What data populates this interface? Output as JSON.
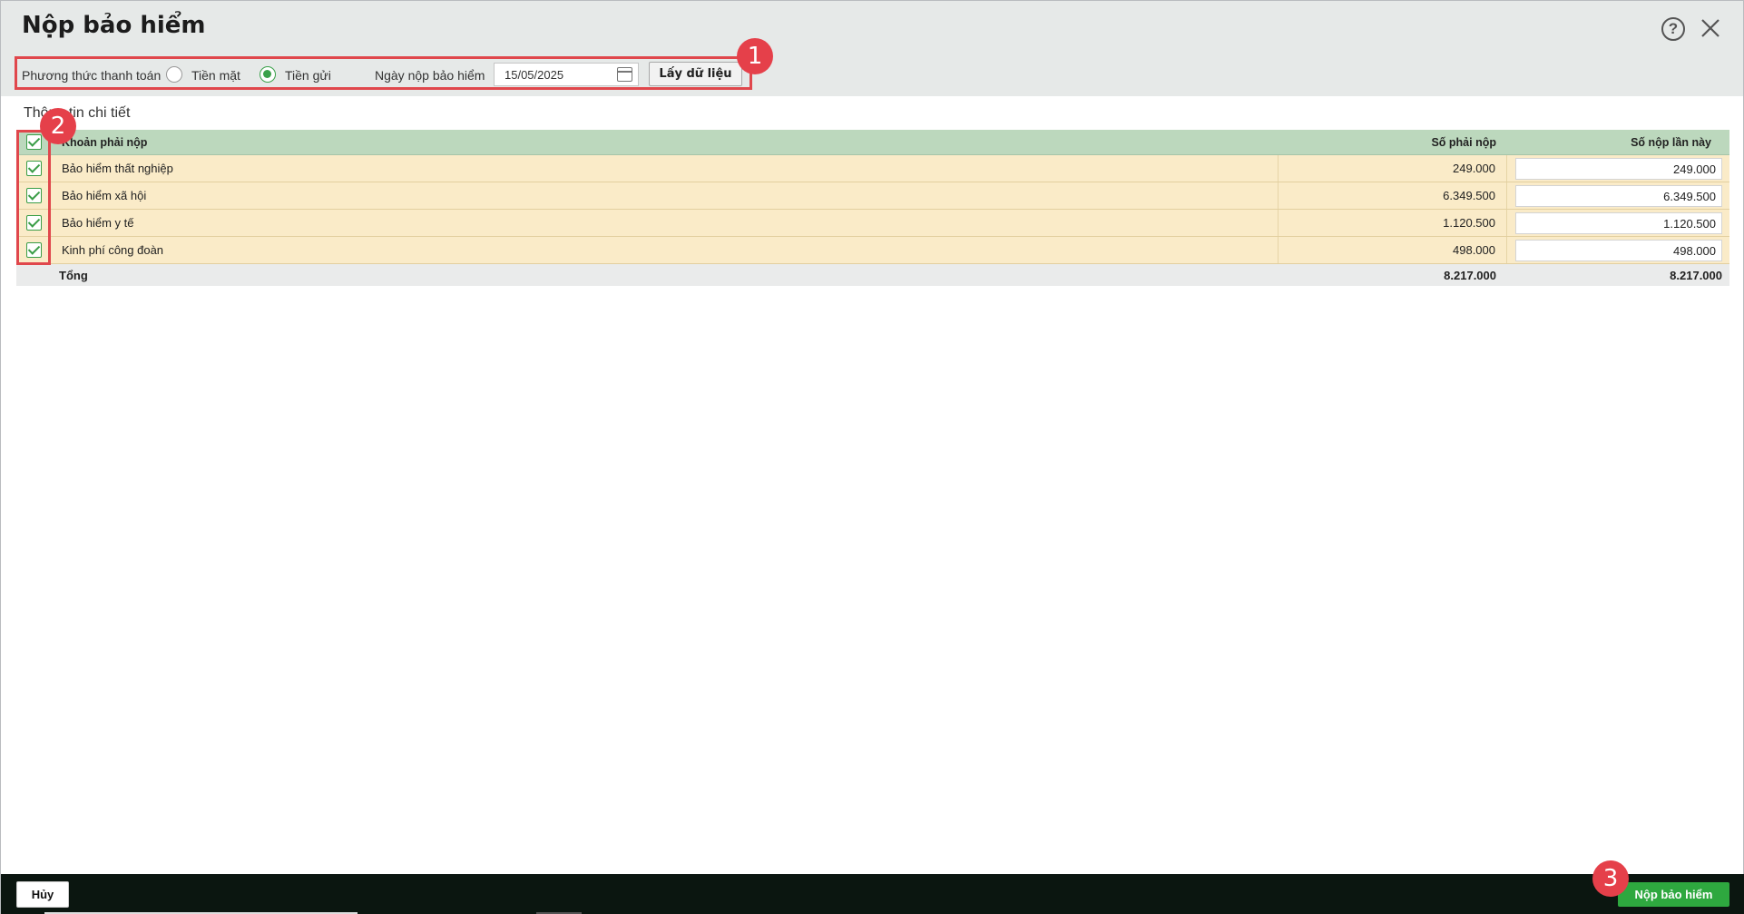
{
  "dialog": {
    "title": "Nộp bảo hiểm",
    "help_icon": "question-circle-icon",
    "close_icon": "close-icon"
  },
  "toolbar": {
    "payment_method_label": "Phương thức thanh toán",
    "options": [
      {
        "label": "Tiền mặt",
        "selected": false
      },
      {
        "label": "Tiền gửi",
        "selected": true
      }
    ],
    "date_label": "Ngày nộp bảo hiểm",
    "date_value": "15/05/2025",
    "fetch_label": "Lấy dữ liệu"
  },
  "section": {
    "title": "Thông tin chi tiết"
  },
  "table": {
    "headers": {
      "name": "Khoản phải nộp",
      "due": "Số phải nộp",
      "pay": "Số nộp lần này"
    },
    "rows": [
      {
        "name": "Bảo hiểm thất nghiệp",
        "due": "249.000",
        "pay": "249.000",
        "checked": true
      },
      {
        "name": "Bảo hiểm xã hội",
        "due": "6.349.500",
        "pay": "6.349.500",
        "checked": true
      },
      {
        "name": "Bảo hiểm y tế",
        "due": "1.120.500",
        "pay": "1.120.500",
        "checked": true
      },
      {
        "name": "Kinh phí công đoàn",
        "due": "498.000",
        "pay": "498.000",
        "checked": true
      }
    ],
    "total": {
      "label": "Tổng",
      "due": "8.217.000",
      "pay": "8.217.000"
    }
  },
  "footer": {
    "cancel_label": "Hủy",
    "submit_label": "Nộp bảo hiểm"
  },
  "annotations": {
    "badge1": "1",
    "badge2": "2",
    "badge3": "3"
  },
  "colors": {
    "accent": "#2ea83f",
    "highlight": "#e0474c",
    "header_row": "#bcd8bd",
    "data_row": "#faebc8"
  }
}
